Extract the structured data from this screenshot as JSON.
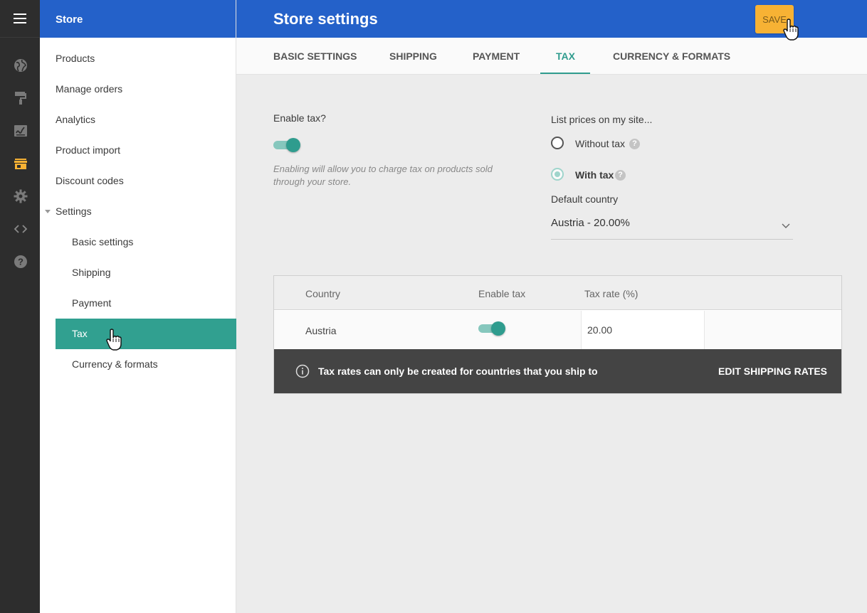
{
  "sidebar": {
    "title": "Store",
    "items": [
      {
        "label": "Products"
      },
      {
        "label": "Manage orders"
      },
      {
        "label": "Analytics"
      },
      {
        "label": "Product import"
      },
      {
        "label": "Discount codes"
      },
      {
        "label": "Settings"
      }
    ],
    "subitems": [
      {
        "label": "Basic settings"
      },
      {
        "label": "Shipping"
      },
      {
        "label": "Payment"
      },
      {
        "label": "Tax"
      },
      {
        "label": "Currency & formats"
      }
    ]
  },
  "rail": {
    "icons": [
      "globe-icon",
      "paint-roller-icon",
      "signature-icon",
      "store-icon",
      "gear-icon",
      "code-icon",
      "help-icon"
    ],
    "active_color": "#f7b234"
  },
  "header": {
    "title": "Store settings",
    "save_label": "SAVE"
  },
  "tabs": [
    {
      "label": "BASIC SETTINGS"
    },
    {
      "label": "SHIPPING"
    },
    {
      "label": "PAYMENT"
    },
    {
      "label": "TAX"
    },
    {
      "label": "CURRENCY & FORMATS"
    }
  ],
  "tax": {
    "enable_label": "Enable tax?",
    "enabled": true,
    "enable_hint_1": "Enabling will allow you to charge tax on products sold",
    "enable_hint_2": "through your store.",
    "list_prices_label": "List prices on my site...",
    "option_without": "Without tax",
    "option_with": "With tax",
    "selected_option": "With tax",
    "default_country_label": "Default country",
    "default_country_value": "Austria - 20.00%"
  },
  "table": {
    "headers": [
      "Country",
      "Enable tax",
      "Tax rate (%)"
    ],
    "rows": [
      {
        "country": "Austria",
        "enabled": true,
        "rate": "20.00"
      }
    ],
    "notice": "Tax rates can only be created for countries that you ship to",
    "notice_action": "EDIT SHIPPING RATES"
  },
  "colors": {
    "brand_blue": "#2461c9",
    "accent_teal": "#31a090",
    "save_orange": "#f7b234"
  }
}
